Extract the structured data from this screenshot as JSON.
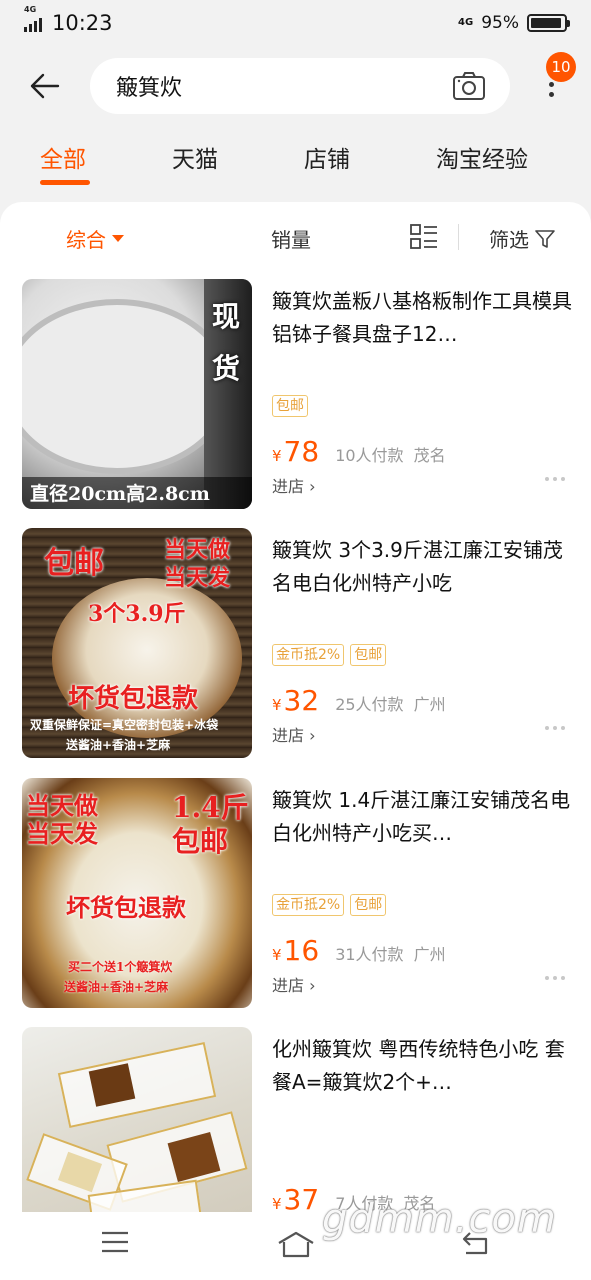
{
  "status": {
    "time": "10:23",
    "net_tag": "4G",
    "net_right": "4G",
    "battery": "95%",
    "battery_level": 0.95
  },
  "search": {
    "query": "簸箕炊"
  },
  "header": {
    "badge_count": "10"
  },
  "tabs": [
    {
      "label": "全部",
      "active": true
    },
    {
      "label": "天猫"
    },
    {
      "label": "店铺"
    },
    {
      "label": "淘宝经验"
    }
  ],
  "sort": {
    "comprehensive": "综合",
    "sales": "销量",
    "filter": "筛选"
  },
  "items": [
    {
      "title": "簸箕炊盖粄八基格粄制作工具模具铝钵子餐具盘子12…",
      "tags": [
        "包邮"
      ],
      "price": "78",
      "sales": "10人付款",
      "location": "茂名",
      "shop": "进店 ›",
      "img_text": [
        "现",
        "货",
        "直径20cm高2.8cm"
      ]
    },
    {
      "title": "簸箕炊 3个3.9斤湛江廉江安铺茂名电白化州特产小吃",
      "tags": [
        "金币抵2%",
        "包邮"
      ],
      "price": "32",
      "sales": "25人付款",
      "location": "广州",
      "shop": "进店 ›",
      "img_text": [
        "包邮",
        "当天做",
        "当天发",
        "3个3.9斤",
        "坏货包退款",
        "双重保鲜保证=真空密封包装+冰袋",
        "送酱油+香油+芝麻"
      ]
    },
    {
      "title": "簸箕炊 1.4斤湛江廉江安铺茂名电白化州特产小吃买…",
      "tags": [
        "金币抵2%",
        "包邮"
      ],
      "price": "16",
      "sales": "31人付款",
      "location": "广州",
      "shop": "进店 ›",
      "img_text": [
        "当天做",
        "当天发",
        "1.4斤",
        "包邮",
        "坏货包退款",
        "买二个送1个簸箕炊",
        "送酱油+香油+芝麻"
      ]
    },
    {
      "title": "化州簸箕炊 粤西传统特色小吃 套餐A=簸箕炊2个+…",
      "tags": [],
      "price": "37",
      "sales": "7人付款",
      "location": "茂名",
      "shop": "",
      "img_text": []
    }
  ],
  "currency_symbol": "¥",
  "watermark": "gdmm.com"
}
